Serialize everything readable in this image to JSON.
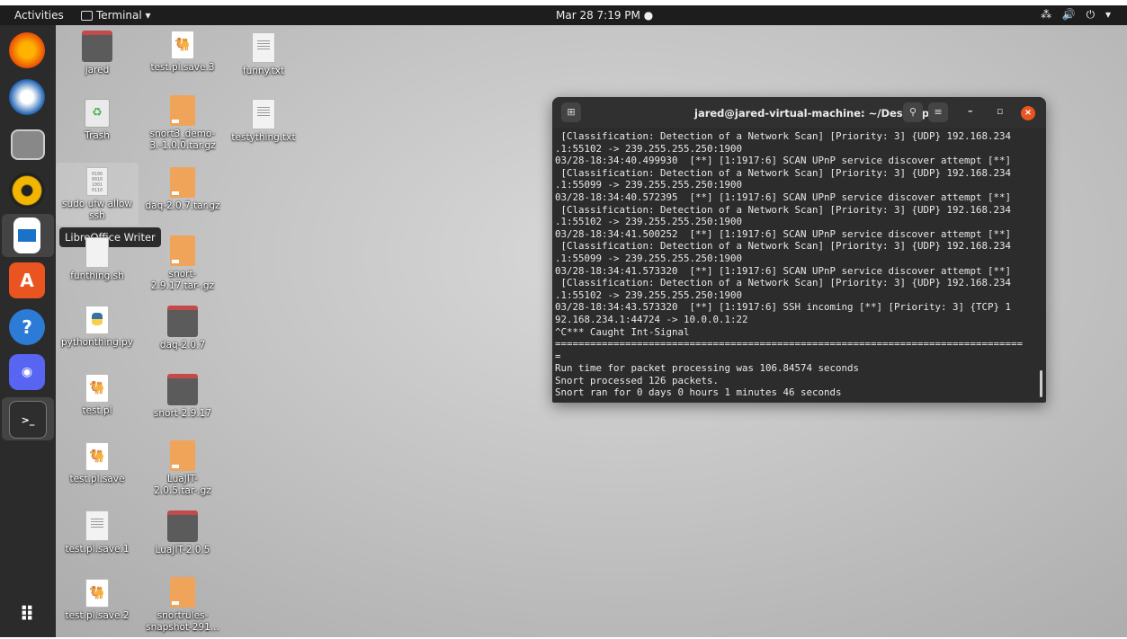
{
  "topbar": {
    "activities": "Activities",
    "app_menu": "Terminal ▾",
    "clock": "Mar 28  7:19 PM  ●",
    "tray": "⁂ 🔊 ⏻ ▾"
  },
  "dock": {
    "tooltip": "LibreOffice Writer"
  },
  "desktop": {
    "col1": [
      "jared",
      "Trash",
      "sudo ufw allow ssh",
      "funthing.sh",
      "pythonthing.py",
      "test.pl",
      "test.pl.save",
      "test.pl.save.1",
      "test.pl.save.2"
    ],
    "col2": [
      "test.pl.save.3",
      "snort3_demo-3.-1.0.0.tar.gz",
      "daq-2.0.7.tar.gz",
      "snort-2.9.17.tar-.gz",
      "daq-2.0.7",
      "snort-2.9.17",
      "LuaJIT-2.0.5.tar-.gz",
      "LuaJIT-2.0.5",
      "snortrules-snapshot-291..."
    ],
    "col3": [
      "funny.txt",
      "testything.txt"
    ]
  },
  "terminal": {
    "title": "jared@jared-virtual-machine: ~/Desktop",
    "lines": [
      " [Classification: Detection of a Network Scan] [Priority: 3] {UDP} 192.168.234",
      ".1:55102 -> 239.255.255.250:1900",
      "03/28-18:34:40.499930  [**] [1:1917:6] SCAN UPnP service discover attempt [**]",
      " [Classification: Detection of a Network Scan] [Priority: 3] {UDP} 192.168.234",
      ".1:55099 -> 239.255.255.250:1900",
      "03/28-18:34:40.572395  [**] [1:1917:6] SCAN UPnP service discover attempt [**]",
      " [Classification: Detection of a Network Scan] [Priority: 3] {UDP} 192.168.234",
      ".1:55102 -> 239.255.255.250:1900",
      "03/28-18:34:41.500252  [**] [1:1917:6] SCAN UPnP service discover attempt [**]",
      " [Classification: Detection of a Network Scan] [Priority: 3] {UDP} 192.168.234",
      ".1:55099 -> 239.255.255.250:1900",
      "03/28-18:34:41.573320  [**] [1:1917:6] SCAN UPnP service discover attempt [**]",
      " [Classification: Detection of a Network Scan] [Priority: 3] {UDP} 192.168.234",
      ".1:55102 -> 239.255.255.250:1900",
      "03/28-18:34:43.573320  [**] [1:1917:6] SSH incoming [**] [Priority: 3] {TCP} 1",
      "92.168.234.1:44724 -> 10.0.0.1:22",
      "^C*** Caught Int-Signal",
      "================================================================================",
      "=",
      "Run time for packet processing was 106.84574 seconds",
      "Snort processed 126 packets.",
      "Snort ran for 0 days 0 hours 1 minutes 46 seconds"
    ]
  }
}
